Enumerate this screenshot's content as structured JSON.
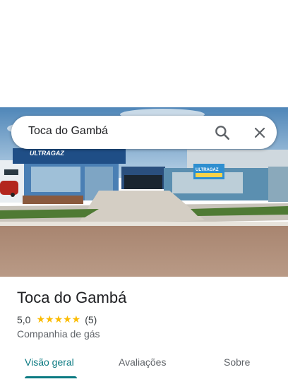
{
  "search": {
    "query": "Toca do Gambá"
  },
  "photo": {
    "sign_text": "ULTRAGAZ",
    "banner_text": "ULTRAGAZ"
  },
  "place": {
    "title": "Toca do Gambá",
    "rating": "5,0",
    "stars": "★★★★★",
    "review_count": "(5)",
    "category": "Companhia de gás"
  },
  "tabs": [
    {
      "label": "Visão geral",
      "active": true
    },
    {
      "label": "Avaliações",
      "active": false
    },
    {
      "label": "Sobre",
      "active": false
    }
  ],
  "colors": {
    "accent": "#0b7a82",
    "star": "#fbbc04"
  },
  "icons": [
    "search-icon",
    "close-icon"
  ]
}
